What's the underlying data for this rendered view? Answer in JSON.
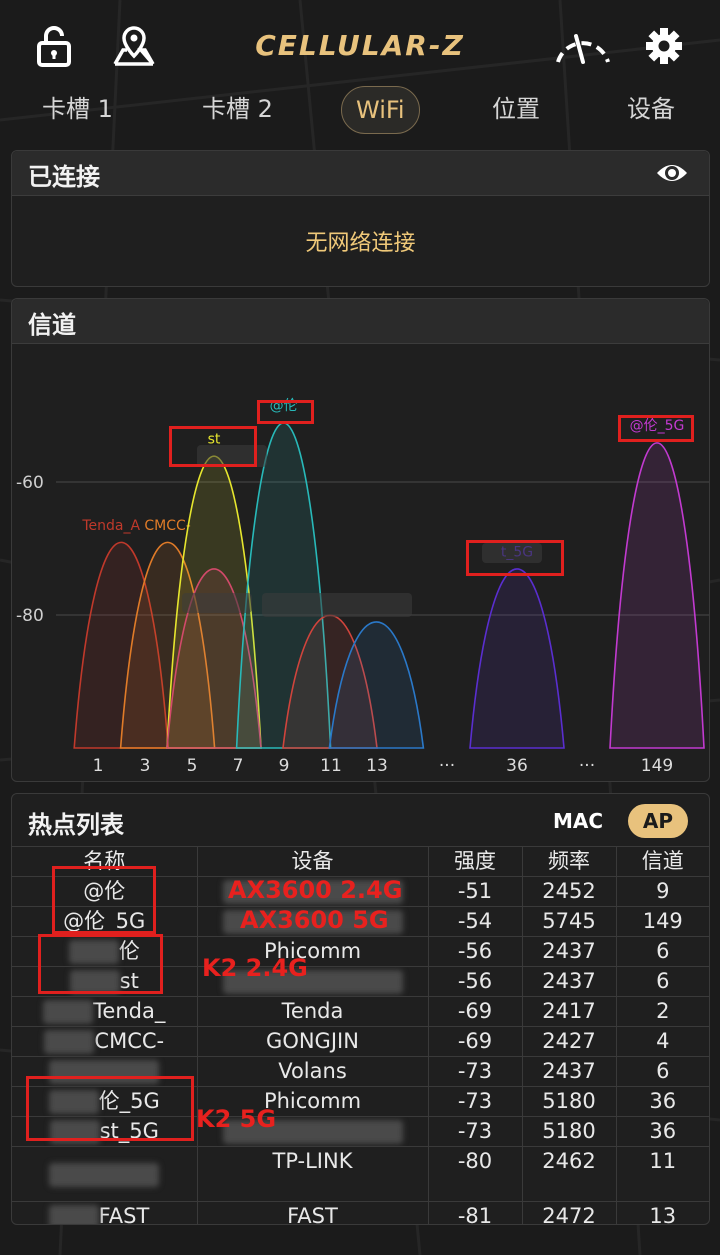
{
  "app": {
    "title": "CELLULAR-Z"
  },
  "icons": {
    "lock": "lock-icon",
    "map": "map-pin-icon",
    "speed": "speedometer-icon",
    "settings": "gear-icon",
    "eye": "eye-icon"
  },
  "colors": {
    "accent": "#e8c27d",
    "background": "#1b1b1b",
    "annotation_red": "#e0201e"
  },
  "tabs": [
    {
      "label": "卡槽 1",
      "active": false
    },
    {
      "label": "卡槽 2",
      "active": false
    },
    {
      "label": "WiFi",
      "active": true
    },
    {
      "label": "位置",
      "active": false
    },
    {
      "label": "设备",
      "active": false
    }
  ],
  "connected": {
    "title": "已连接",
    "status": "无网络连接"
  },
  "channel": {
    "title": "信道",
    "chart_data": {
      "type": "area",
      "ylabels": [
        "-60",
        "-80"
      ],
      "xlabels": [
        "1",
        "3",
        "5",
        "7",
        "9",
        "11",
        "13",
        "···",
        "36",
        "···",
        "149"
      ],
      "series": [
        {
          "name": "Tenda_A",
          "channel": 2,
          "strength": -69,
          "color": "#c0392b"
        },
        {
          "name": "CMCC-",
          "channel": 4,
          "strength": -69,
          "color": "#e07b28"
        },
        {
          "name": "st",
          "channel": 6,
          "strength": -56,
          "color": "#e6e62e"
        },
        {
          "name": "",
          "channel": 6,
          "strength": -73,
          "color": "#d24a6a"
        },
        {
          "name": "@伦",
          "channel": 9,
          "strength": -51,
          "color": "#28b9b9"
        },
        {
          "name": "",
          "channel": 11,
          "strength": -80,
          "color": "#d0443c"
        },
        {
          "name": "",
          "channel": 13,
          "strength": -81,
          "color": "#2a78c8"
        },
        {
          "name": "t_5G",
          "channel": 36,
          "strength": -73,
          "color": "#5a2ed0"
        },
        {
          "name": "@伦_5G",
          "channel": 149,
          "strength": -54,
          "color": "#c23ad0"
        }
      ]
    }
  },
  "hotspots": {
    "title": "热点列表",
    "mac_label": "MAC",
    "ap_label": "AP",
    "columns": [
      "名称",
      "设备",
      "强度",
      "频率",
      "信道"
    ],
    "rows": [
      {
        "name": "@伦",
        "device": "",
        "strength": "-51",
        "freq": "2452",
        "channel": "9"
      },
      {
        "name": "@伦_5G",
        "device": "",
        "strength": "-54",
        "freq": "5745",
        "channel": "149"
      },
      {
        "name": "伦",
        "device": "Phicomm",
        "strength": "-56",
        "freq": "2437",
        "channel": "6"
      },
      {
        "name": "st",
        "device": "",
        "strength": "-56",
        "freq": "2437",
        "channel": "6"
      },
      {
        "name": "Tenda_",
        "device": "Tenda",
        "strength": "-69",
        "freq": "2417",
        "channel": "2"
      },
      {
        "name": "CMCC-",
        "device": "GONGJIN",
        "strength": "-69",
        "freq": "2427",
        "channel": "4"
      },
      {
        "name": "",
        "device": "Volans",
        "strength": "-73",
        "freq": "2437",
        "channel": "6"
      },
      {
        "name": "伦_5G",
        "device": "Phicomm",
        "strength": "-73",
        "freq": "5180",
        "channel": "36"
      },
      {
        "name": "st_5G",
        "device": "",
        "strength": "-73",
        "freq": "5180",
        "channel": "36"
      },
      {
        "name": "",
        "device": "TP-LINK",
        "strength": "-80",
        "freq": "2462",
        "channel": "11"
      },
      {
        "name": "FAST_",
        "device": "FAST",
        "strength": "-81",
        "freq": "2472",
        "channel": "13"
      }
    ]
  },
  "annotations": {
    "ax_24": "AX3600 2.4G",
    "ax_5": "AX3600 5G",
    "k2_24": "K2 2.4G",
    "k2_5": "K2 5G"
  }
}
